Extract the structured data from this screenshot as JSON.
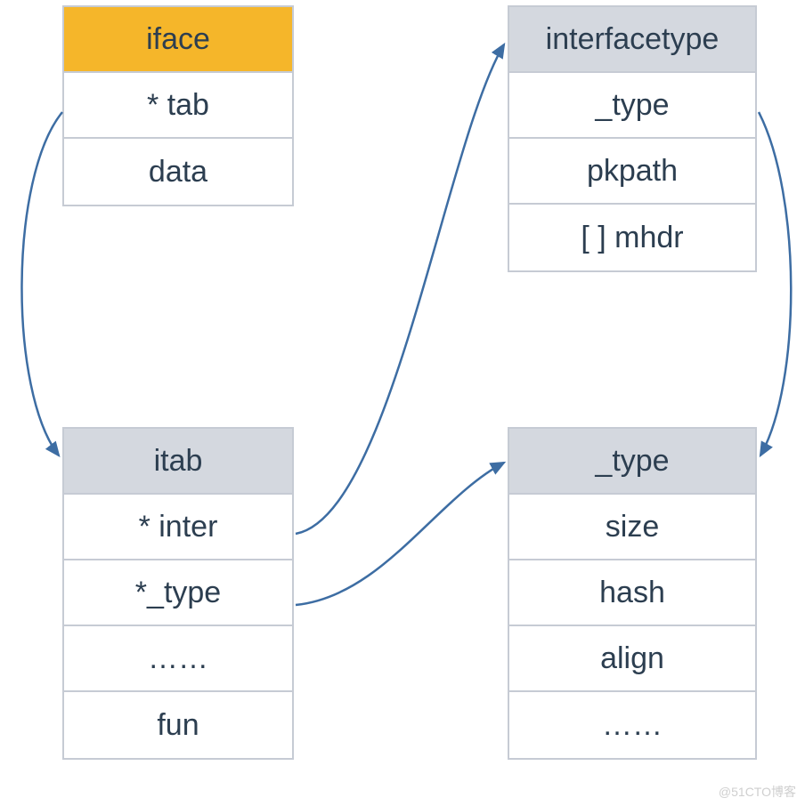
{
  "boxes": {
    "iface": {
      "title": "iface",
      "fields": [
        "* tab",
        "data"
      ]
    },
    "itab": {
      "title": "itab",
      "fields": [
        "* inter",
        "*_type",
        "……",
        "fun"
      ]
    },
    "interfacetype": {
      "title": "interfacetype",
      "fields": [
        "_type",
        "pkpath",
        "[ ] mhdr"
      ]
    },
    "type": {
      "title": "_type",
      "fields": [
        "size",
        "hash",
        "align",
        "……"
      ]
    }
  },
  "colors": {
    "highlight": "#f5b62a",
    "header": "#d4d8df",
    "border": "#c6cbd4",
    "text": "#2c3e50",
    "arrow": "#3d6da3"
  },
  "watermark": "@51CTO博客"
}
